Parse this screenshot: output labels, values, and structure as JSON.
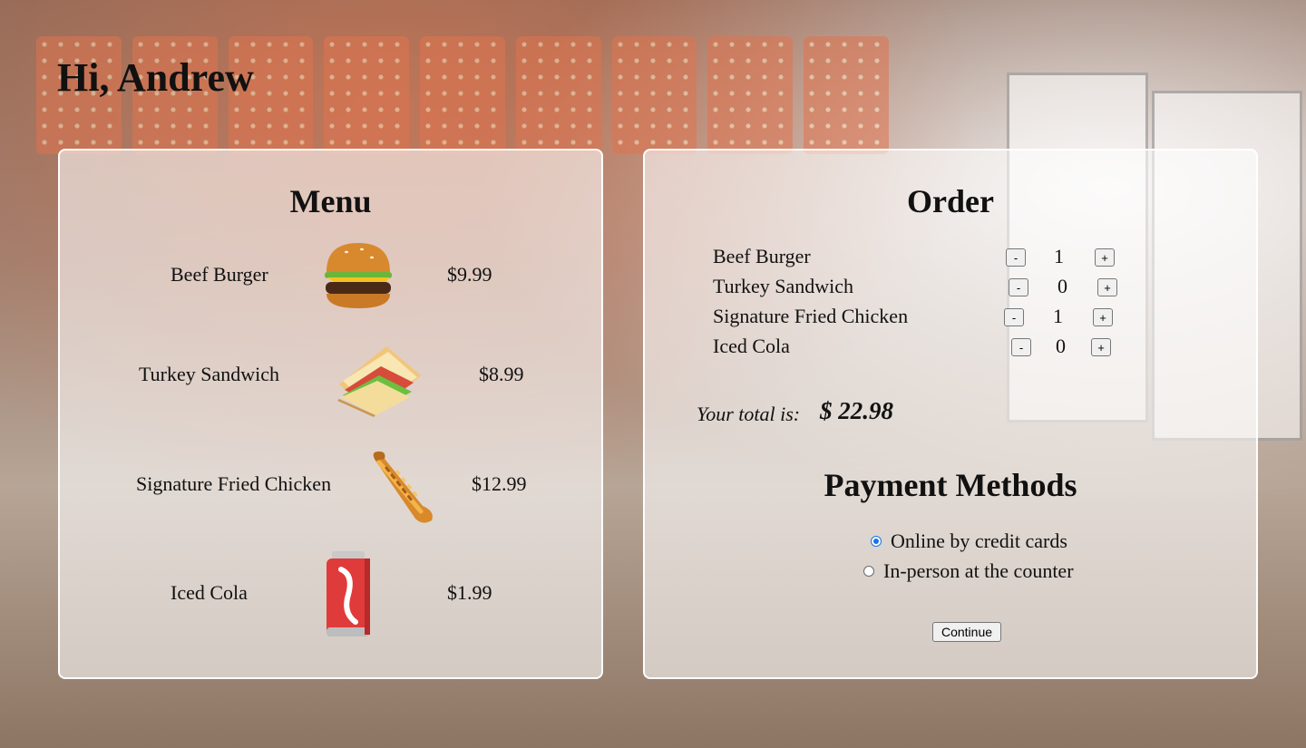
{
  "greeting": "Hi, Andrew",
  "menu": {
    "title": "Menu",
    "items": [
      {
        "name": "Beef Burger",
        "price": "$9.99",
        "icon": "burger-icon"
      },
      {
        "name": "Turkey Sandwich",
        "price": "$8.99",
        "icon": "sandwich-icon"
      },
      {
        "name": "Signature Fried Chicken",
        "price": "$12.99",
        "icon": "fried-chicken-icon"
      },
      {
        "name": "Iced Cola",
        "price": "$1.99",
        "icon": "cola-can-icon"
      }
    ]
  },
  "order": {
    "title": "Order",
    "rows": [
      {
        "name": "Beef Burger",
        "qty": "1"
      },
      {
        "name": "Turkey Sandwich",
        "qty": "0"
      },
      {
        "name": "Signature Fried Chicken",
        "qty": "1"
      },
      {
        "name": "Iced Cola",
        "qty": "0"
      }
    ],
    "decrement_label": "-",
    "increment_label": "+",
    "total_label": "Your total is:",
    "total_value": "$ 22.98"
  },
  "payment": {
    "title": "Payment Methods",
    "options": [
      {
        "label": "Online by credit cards",
        "selected": true
      },
      {
        "label": "In-person at the counter",
        "selected": false
      }
    ],
    "continue_label": "Continue"
  },
  "colors": {
    "radio_accent": "#1a73e8",
    "panel_background": "rgba(255,255,255,0.58)"
  }
}
